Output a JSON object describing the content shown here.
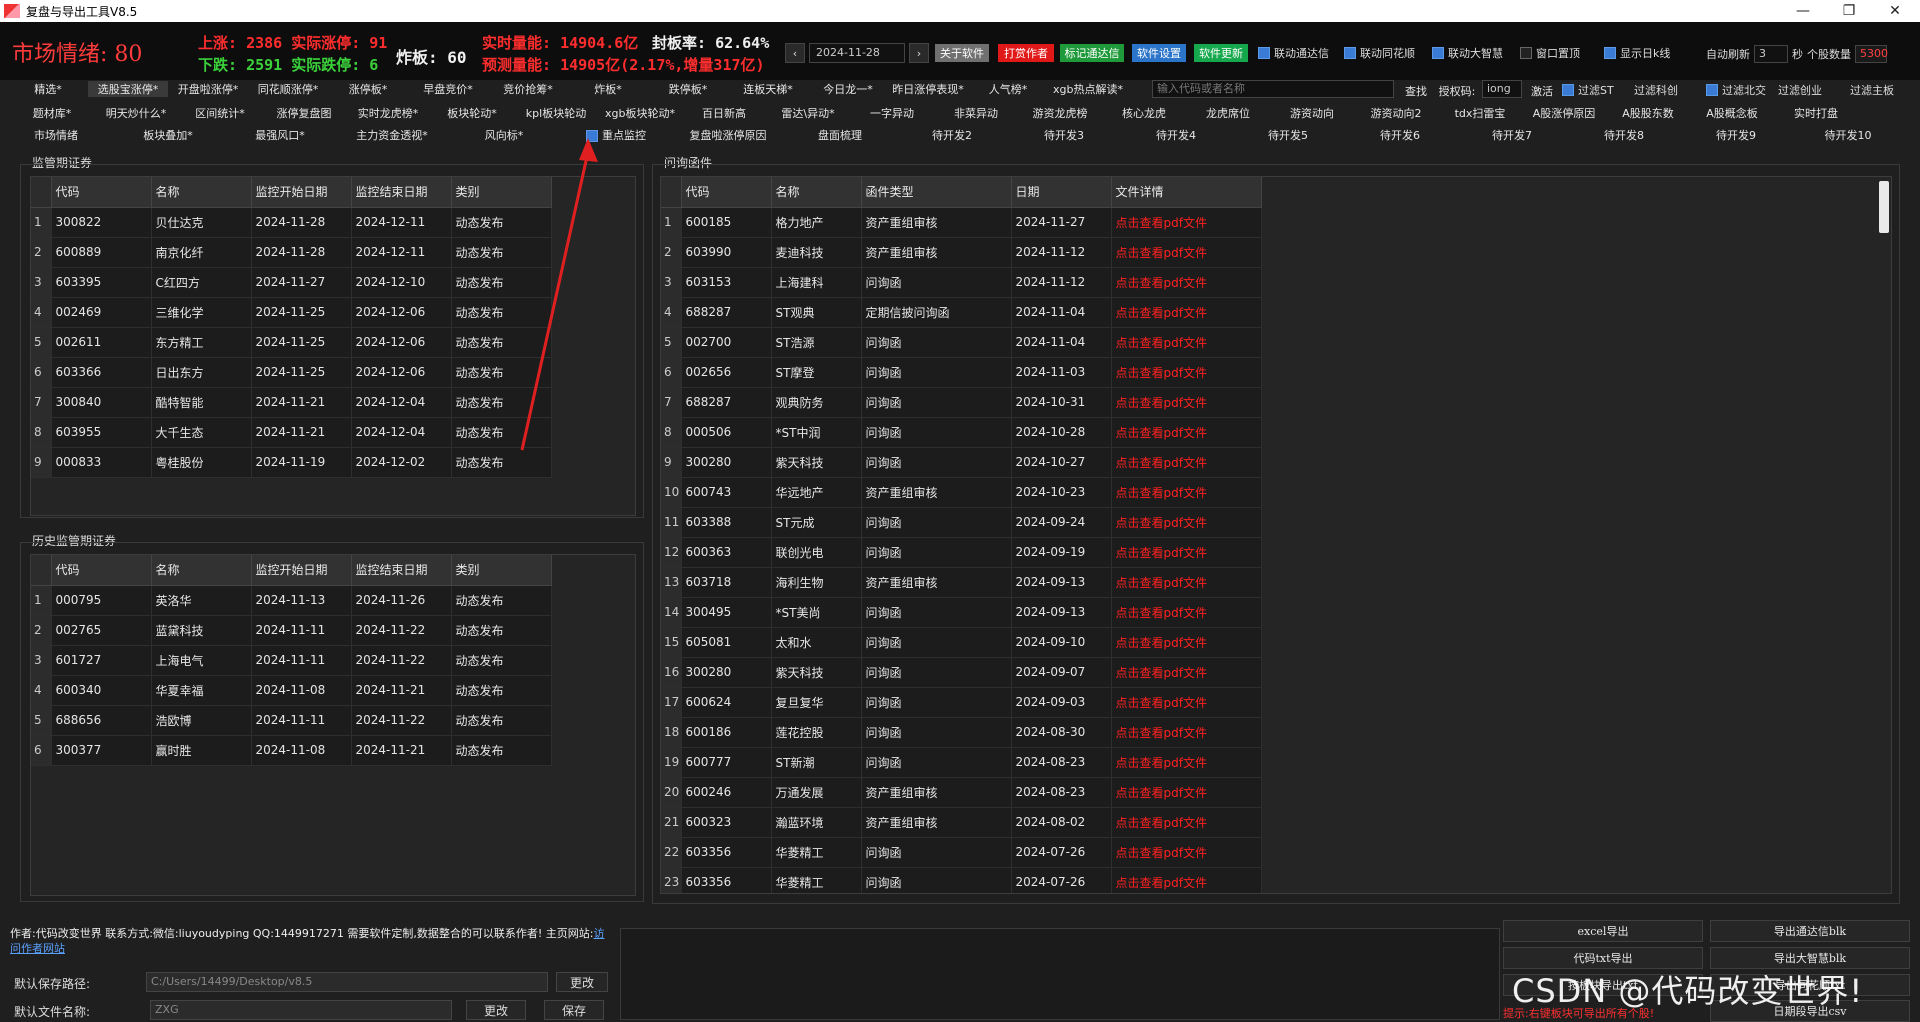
{
  "window": {
    "title": "复盘与导出工具V8.5"
  },
  "topbar": {
    "mood_label": "市场情绪:",
    "mood_value": "80",
    "up_label": "上涨:",
    "up_value": "2386",
    "real_up_label": "实际涨停:",
    "real_up_value": "91",
    "down_label": "下跌:",
    "down_value": "2591",
    "real_down_label": "实际跌停:",
    "real_down_value": "6",
    "blast_label": "炸板:",
    "blast_value": "60",
    "volume_label": "实时量能:",
    "volume_value": "14904.6亿",
    "seal_label": "封板率:",
    "seal_value": "62.64%",
    "pred_label": "预测量能:",
    "pred_value": "14905亿(2.17%,增量317亿)",
    "date": "2024-11-28",
    "prev": "‹",
    "next": "›",
    "buttons": {
      "about": "关于软件",
      "tip": "打赏作者",
      "mark": "标记通达信",
      "settings": "软件设置",
      "update": "软件更新"
    },
    "checks": {
      "link_tdx": "联动通达信",
      "link_ths": "联动同花顺",
      "link_dzh": "联动大智慧",
      "pin": "窗口置顶",
      "kline": "显示日k线"
    },
    "auto_refresh_label": "自动刷新",
    "auto_refresh_value": "3",
    "sec_label": "秒",
    "stock_count_label": "个股数量",
    "stock_count_value": "5300"
  },
  "menu_row1": [
    "精选*",
    "选股宝涨停*",
    "开盘啦涨停*",
    "同花顺涨停*",
    "涨停板*",
    "早盘竞价*",
    "竞价抢筹*",
    "炸板*",
    "跌停板*",
    "连板天梯*",
    "今日龙一*",
    "昨日涨停表现*",
    "人气榜*",
    "xgb热点解读*"
  ],
  "search": {
    "placeholder": "输入代码或者名称",
    "button": "查找",
    "auth_label": "授权码:",
    "auth_value": "iong",
    "activate": "激活"
  },
  "filters": [
    "过滤ST",
    "过滤科创",
    "过滤北交",
    "过滤创业",
    "过滤主板"
  ],
  "menu_row2": [
    "题材库*",
    "明天炒什么*",
    "区间统计*",
    "涨停复盘图",
    "实时龙虎榜*",
    "板块轮动*",
    "kpl板块轮动",
    "xgb板块轮动*",
    "百日新高",
    "雷达\\异动*",
    "一字异动",
    "非菜异动",
    "游资龙虎榜",
    "核心龙虎",
    "龙虎席位",
    "游资动向",
    "游资动向2",
    "tdx扫雷宝",
    "A股涨停原因",
    "A股股东数",
    "A股概念板",
    "实时打盘"
  ],
  "menu_row3": [
    "市场情绪",
    "板块叠加*",
    "最强风口*",
    "主力资金透视*",
    "风向标*",
    "重点监控",
    "复盘啦涨停原因",
    "盘面梳理",
    "待开发2",
    "待开发3",
    "待开发4",
    "待开发5",
    "待开发6",
    "待开发7",
    "待开发8",
    "待开发9",
    "待开发10"
  ],
  "supervision": {
    "label": "监管期证券",
    "headers": [
      "代码",
      "名称",
      "监控开始日期",
      "监控结束日期",
      "类别"
    ],
    "rows": [
      [
        "1",
        "300822",
        "贝仕达克",
        "2024-11-28",
        "2024-12-11",
        "动态发布"
      ],
      [
        "2",
        "600889",
        "南京化纤",
        "2024-11-28",
        "2024-12-11",
        "动态发布"
      ],
      [
        "3",
        "603395",
        "C红四方",
        "2024-11-27",
        "2024-12-10",
        "动态发布"
      ],
      [
        "4",
        "002469",
        "三维化学",
        "2024-11-25",
        "2024-12-06",
        "动态发布"
      ],
      [
        "5",
        "002611",
        "东方精工",
        "2024-11-25",
        "2024-12-06",
        "动态发布"
      ],
      [
        "6",
        "603366",
        "日出东方",
        "2024-11-25",
        "2024-12-06",
        "动态发布"
      ],
      [
        "7",
        "300840",
        "酷特智能",
        "2024-11-21",
        "2024-12-04",
        "动态发布"
      ],
      [
        "8",
        "603955",
        "大千生态",
        "2024-11-21",
        "2024-12-04",
        "动态发布"
      ],
      [
        "9",
        "000833",
        "粤桂股份",
        "2024-11-19",
        "2024-12-02",
        "动态发布"
      ]
    ]
  },
  "history": {
    "label": "历史监管期证券",
    "headers": [
      "代码",
      "名称",
      "监控开始日期",
      "监控结束日期",
      "类别"
    ],
    "rows": [
      [
        "1",
        "000795",
        "英洛华",
        "2024-11-13",
        "2024-11-26",
        "动态发布"
      ],
      [
        "2",
        "002765",
        "蓝黛科技",
        "2024-11-11",
        "2024-11-22",
        "动态发布"
      ],
      [
        "3",
        "601727",
        "上海电气",
        "2024-11-11",
        "2024-11-22",
        "动态发布"
      ],
      [
        "4",
        "600340",
        "华夏幸福",
        "2024-11-08",
        "2024-11-21",
        "动态发布"
      ],
      [
        "5",
        "688656",
        "浩欧博",
        "2024-11-11",
        "2024-11-22",
        "动态发布"
      ],
      [
        "6",
        "300377",
        "赢时胜",
        "2024-11-08",
        "2024-11-21",
        "动态发布"
      ]
    ]
  },
  "inquiry": {
    "label": "问询函件",
    "headers": [
      "代码",
      "名称",
      "函件类型",
      "日期",
      "文件详情"
    ],
    "rows": [
      [
        "1",
        "600185",
        "格力地产",
        "资产重组审核",
        "2024-11-27",
        "点击查看pdf文件"
      ],
      [
        "2",
        "603990",
        "麦迪科技",
        "资产重组审核",
        "2024-11-12",
        "点击查看pdf文件"
      ],
      [
        "3",
        "603153",
        "上海建科",
        "问询函",
        "2024-11-12",
        "点击查看pdf文件"
      ],
      [
        "4",
        "688287",
        "ST观典",
        "定期信披问询函",
        "2024-11-04",
        "点击查看pdf文件"
      ],
      [
        "5",
        "002700",
        "ST浩源",
        "问询函",
        "2024-11-04",
        "点击查看pdf文件"
      ],
      [
        "6",
        "002656",
        "ST摩登",
        "问询函",
        "2024-11-03",
        "点击查看pdf文件"
      ],
      [
        "7",
        "688287",
        "观典防务",
        "问询函",
        "2024-10-31",
        "点击查看pdf文件"
      ],
      [
        "8",
        "000506",
        "*ST中润",
        "问询函",
        "2024-10-28",
        "点击查看pdf文件"
      ],
      [
        "9",
        "300280",
        "紫天科技",
        "问询函",
        "2024-10-27",
        "点击查看pdf文件"
      ],
      [
        "10",
        "600743",
        "华远地产",
        "资产重组审核",
        "2024-10-23",
        "点击查看pdf文件"
      ],
      [
        "11",
        "603388",
        "ST元成",
        "问询函",
        "2024-09-24",
        "点击查看pdf文件"
      ],
      [
        "12",
        "600363",
        "联创光电",
        "问询函",
        "2024-09-19",
        "点击查看pdf文件"
      ],
      [
        "13",
        "603718",
        "海利生物",
        "资产重组审核",
        "2024-09-13",
        "点击查看pdf文件"
      ],
      [
        "14",
        "300495",
        "*ST美尚",
        "问询函",
        "2024-09-13",
        "点击查看pdf文件"
      ],
      [
        "15",
        "605081",
        "太和水",
        "问询函",
        "2024-09-10",
        "点击查看pdf文件"
      ],
      [
        "16",
        "300280",
        "紫天科技",
        "问询函",
        "2024-09-07",
        "点击查看pdf文件"
      ],
      [
        "17",
        "600624",
        "复旦复华",
        "问询函",
        "2024-09-03",
        "点击查看pdf文件"
      ],
      [
        "18",
        "600186",
        "莲花控股",
        "问询函",
        "2024-08-30",
        "点击查看pdf文件"
      ],
      [
        "19",
        "600777",
        "ST新潮",
        "问询函",
        "2024-08-23",
        "点击查看pdf文件"
      ],
      [
        "20",
        "600246",
        "万通发展",
        "资产重组审核",
        "2024-08-23",
        "点击查看pdf文件"
      ],
      [
        "21",
        "600323",
        "瀚蓝环境",
        "资产重组审核",
        "2024-08-02",
        "点击查看pdf文件"
      ],
      [
        "22",
        "603356",
        "华菱精工",
        "问询函",
        "2024-07-26",
        "点击查看pdf文件"
      ],
      [
        "23",
        "603356",
        "华菱精工",
        "问询函",
        "2024-07-26",
        "点击查看pdf文件"
      ]
    ]
  },
  "bottom": {
    "author_info": "作者:代码改变世界 联系方式:微信:liuyoudyping QQ:1449917271 需要软件定制,数据整合的可以联系作者! 主页网站:",
    "site_link": "访问作者网站",
    "save_path_label": "默认保存路径:",
    "save_path_value": "C:/Users/14499/Desktop/v8.5",
    "change": "更改",
    "file_name_label": "默认文件名称:",
    "file_name_value": "ZXG",
    "change2": "更改",
    "save": "保存",
    "export_buttons": [
      "excel导出",
      "导出通达信blk",
      "代码txt导出",
      "导出大智慧blk",
      "按板块导出txt",
      "导出同花顺txt",
      "日期段导出csv"
    ],
    "tip": "提示:右键板块可导出所有个股!",
    "watermark": "CSDN @代码改变世界!"
  }
}
